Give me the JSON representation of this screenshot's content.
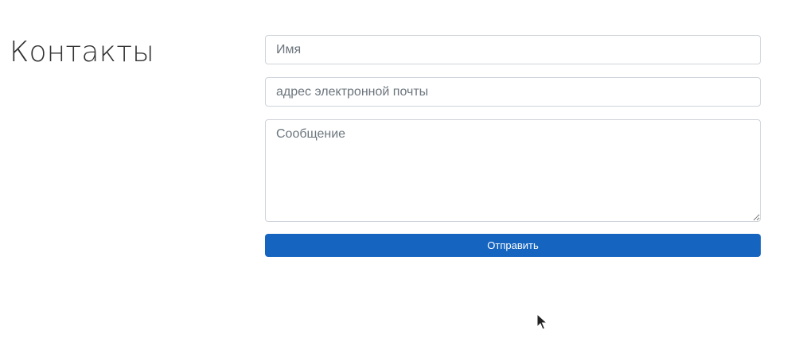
{
  "page": {
    "title": "Контакты"
  },
  "form": {
    "name_placeholder": "Имя",
    "email_placeholder": "адрес электронной почты",
    "message_placeholder": "Сообщение",
    "submit_label": "Отправить"
  },
  "colors": {
    "primary_button": "#1565c0",
    "border": "#ced4da",
    "title_text": "#333333",
    "placeholder_text": "#6c757d"
  },
  "icons": {
    "cursor": "mouse-pointer-icon"
  }
}
